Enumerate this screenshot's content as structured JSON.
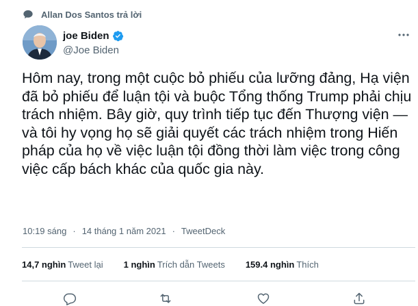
{
  "context": {
    "icon": "chat-bubble-icon",
    "text": "Allan Dos Santos trả lời"
  },
  "author": {
    "avatar_icon": "avatar",
    "display_name": "joe Biden",
    "verified_icon": "verified-badge-icon",
    "handle": "@Joe Biden"
  },
  "more_icon": "more-options-icon",
  "tweet": {
    "text": "Hôm nay, trong một cuộc bỏ phiếu của lưỡng đảng, Hạ viện đã bỏ phiếu để luận tội và buộc Tổng thống Trump phải chịu trách nhiệm. Bây giờ, quy trình tiếp tục đến Thượng viện — và tôi hy vọng họ sẽ giải quyết các trách nhiệm trong Hiến pháp của họ về việc luận tội đồng thời làm việc trong công việc cấp bách khác của quốc gia này."
  },
  "meta": {
    "time": "10:19 sáng",
    "date": "14 tháng 1 năm 2021",
    "separator": "·",
    "source": "TweetDeck"
  },
  "stats": [
    {
      "value": "14,7 nghìn",
      "label": "Tweet lại"
    },
    {
      "value": "1 nghìn",
      "label": "Trích dẫn Tweets"
    },
    {
      "value": "159.4 nghìn",
      "label": "Thích"
    }
  ],
  "actions": [
    "reply-icon",
    "retweet-icon",
    "like-icon",
    "share-icon"
  ],
  "colors": {
    "text": "#0f1419",
    "secondary": "#536471",
    "verified": "#1d9bf0",
    "divider": "#cfd9de"
  }
}
